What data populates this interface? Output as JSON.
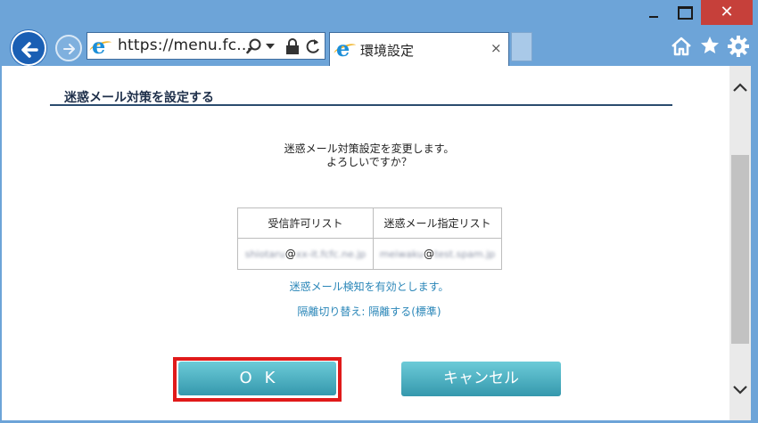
{
  "window": {
    "minimize_icon": "minimize-icon",
    "maximize_icon": "maximize-icon",
    "close_glyph": "✕"
  },
  "nav": {
    "back_icon": "back-arrow-icon",
    "forward_icon": "forward-arrow-icon",
    "url": "https://menu.fc...",
    "tab_title": "環境設定",
    "tab_close": "×",
    "home_icon": "home-icon",
    "favorites_icon": "star-icon",
    "tools_icon": "gear-icon"
  },
  "page": {
    "heading": "迷惑メール対策を設定する",
    "confirm_line1": "迷惑メール対策設定を変更します。",
    "confirm_line2": "よろしいですか？",
    "table": {
      "headers": [
        "受信許可リスト",
        "迷惑メール指定リスト"
      ],
      "allow_local": "shiotaru",
      "allow_domain": "xx-it.fcfc.ne.jp",
      "spam_local": "meiwaku",
      "spam_domain": "test.spam.jp",
      "at": "@"
    },
    "info_detect": "迷惑メール検知を有効とします。",
    "info_isolation": "隔離切り替え: 隔離する(標準)",
    "ok_label": "OK",
    "cancel_label": "キャンセル"
  },
  "colors": {
    "chrome": "#6da4d8",
    "button": "#3598ad",
    "highlight": "#e01a1a",
    "info_text": "#2a86b8"
  }
}
